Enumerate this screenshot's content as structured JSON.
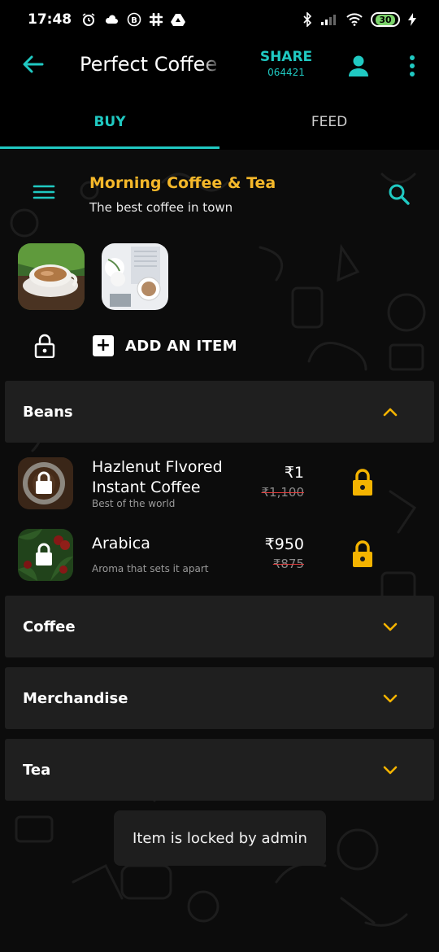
{
  "status_bar": {
    "time": "17:48",
    "battery": "30",
    "left_icons": [
      "alarm-icon",
      "cloud-icon",
      "b-badge-icon",
      "slack-icon",
      "drive-icon"
    ],
    "right_icons": [
      "bluetooth-icon",
      "signal-icon",
      "wifi-icon",
      "battery-icon",
      "charging-icon"
    ]
  },
  "app_bar": {
    "title": "Perfect Coffee",
    "share_label": "SHARE",
    "share_code": "064421"
  },
  "tabs": [
    {
      "label": "BUY",
      "active": true
    },
    {
      "label": "FEED",
      "active": false
    }
  ],
  "store": {
    "name": "Morning Coffee & Tea",
    "tagline": "The best coffee in town"
  },
  "actions": {
    "add_item_label": "ADD AN ITEM"
  },
  "categories": [
    {
      "label": "Beans",
      "expanded": true
    },
    {
      "label": "Coffee",
      "expanded": false
    },
    {
      "label": "Merchandise",
      "expanded": false
    },
    {
      "label": "Tea",
      "expanded": false
    }
  ],
  "items": [
    {
      "name_line1": "Hazlenut Flvored",
      "name_line2": "Instant Coffee",
      "description": "Best of the world",
      "price": "₹1",
      "original_price": "₹1,100",
      "locked": true
    },
    {
      "name_line1": "Arabica",
      "description": "Aroma that sets it apart",
      "price": "₹950",
      "original_price": "₹875",
      "locked": true
    }
  ],
  "toast": {
    "message": "Item is locked by admin"
  },
  "colors": {
    "accent_teal": "#20c9c2",
    "store_name_gold": "#f5b82a",
    "lock_yellow": "#f5b400",
    "strike_red": "#e23c3c"
  }
}
